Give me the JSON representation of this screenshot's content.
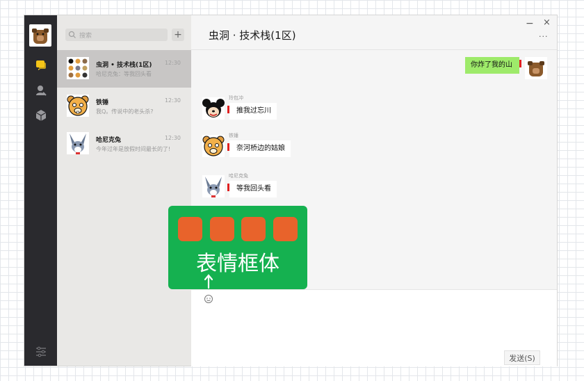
{
  "window": {
    "title": "虫洞 · 技术栈(1区)",
    "minimize_glyph": "−",
    "close_glyph": "×",
    "more_glyph": "···"
  },
  "navbar": {
    "items": [
      "chat-icon",
      "contacts-icon",
      "box-icon"
    ],
    "bottom": "settings-icon"
  },
  "search": {
    "placeholder": "搜索",
    "add_label": "+"
  },
  "conversations": [
    {
      "name": "虫洞 • 技术栈(1区)",
      "time": "12:30",
      "preview": "哈尼克兔：等我回头看",
      "active": true
    },
    {
      "name": "铁锤",
      "time": "12:30",
      "preview": "我Q。传说中的老头杀?",
      "active": false
    },
    {
      "name": "哈尼克兔",
      "time": "12:30",
      "preview": "今年过年是放假时间最长的了!",
      "active": false
    }
  ],
  "messages": [
    {
      "sender": "",
      "text": "你炸了我的山",
      "mine": true
    },
    {
      "sender": "玲包冲",
      "text": "推我过忘川",
      "mine": false
    },
    {
      "sender": "铁锤",
      "text": "奈河桥边的姑娘",
      "mine": false
    },
    {
      "sender": "哈尼克兔",
      "text": "等我回头看",
      "mine": false
    }
  ],
  "composer": {
    "send_label": "发送(S)"
  },
  "overlay": {
    "label": "表情框体",
    "sticker_count": 4
  },
  "colors": {
    "overlay": "#15b150",
    "sticker": "#e8632b",
    "my_bubble": "#9eea6a",
    "accent_bar": "#e02020",
    "nav_active": "#f5c518"
  }
}
